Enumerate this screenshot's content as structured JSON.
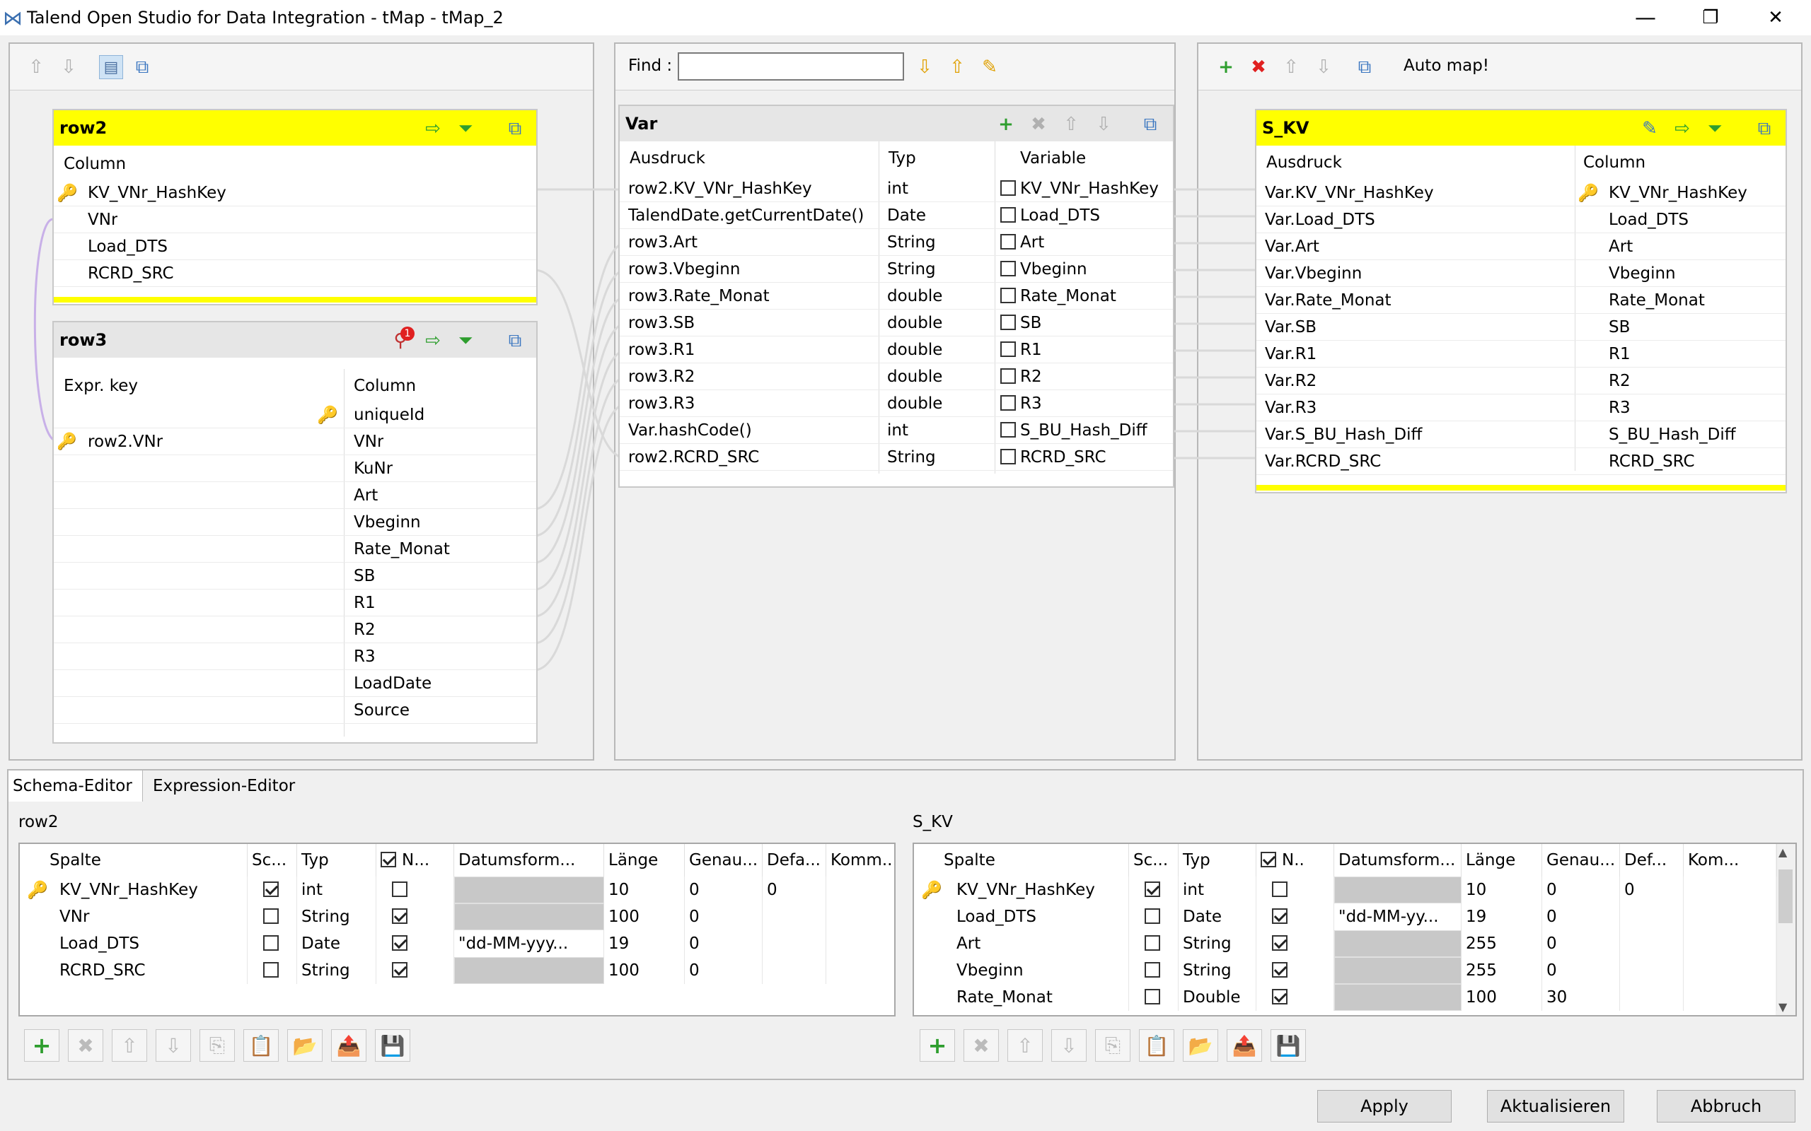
{
  "window": {
    "title": "Talend Open Studio for Data Integration - tMap - tMap_2",
    "minimize": "—",
    "restore": "❐",
    "close": "✕"
  },
  "colors": {
    "header_yellow": "#ffff00",
    "key_icon": "#d4a400",
    "add_green": "#2e9e2e",
    "remove_red": "#e02020"
  },
  "center": {
    "find_label": "Find :",
    "find_value": ""
  },
  "right": {
    "automap_label": "Auto map!"
  },
  "row2": {
    "title": "row2",
    "column_header": "Column",
    "rows": [
      "KV_VNr_HashKey",
      "VNr",
      "Load_DTS",
      "RCRD_SRC"
    ]
  },
  "row3": {
    "title": "row3",
    "expr_header": "Expr. key",
    "column_header": "Column",
    "badge": "1",
    "expr_values": [
      "",
      "row2.VNr"
    ],
    "rows": [
      "uniqueId",
      "VNr",
      "KuNr",
      "Art",
      "Vbeginn",
      "Rate_Monat",
      "SB",
      "R1",
      "R2",
      "R3",
      "LoadDate",
      "Source"
    ]
  },
  "var": {
    "title": "Var",
    "h_expr": "Ausdruck",
    "h_type": "Typ",
    "h_var": "Variable",
    "rows": [
      {
        "expr": "row2.KV_VNr_HashKey",
        "type": "int",
        "var": "KV_VNr_HashKey"
      },
      {
        "expr": "TalendDate.getCurrentDate()",
        "type": "Date",
        "var": "Load_DTS"
      },
      {
        "expr": "row3.Art",
        "type": "String",
        "var": "Art"
      },
      {
        "expr": "row3.Vbeginn",
        "type": "String",
        "var": "Vbeginn"
      },
      {
        "expr": "row3.Rate_Monat",
        "type": "double",
        "var": "Rate_Monat"
      },
      {
        "expr": "row3.SB",
        "type": "double",
        "var": "SB"
      },
      {
        "expr": "row3.R1",
        "type": "double",
        "var": "R1"
      },
      {
        "expr": "row3.R2",
        "type": "double",
        "var": "R2"
      },
      {
        "expr": "row3.R3",
        "type": "double",
        "var": "R3"
      },
      {
        "expr": "Var.hashCode()",
        "type": "int",
        "var": "S_BU_Hash_Diff"
      },
      {
        "expr": "row2.RCRD_SRC",
        "type": "String",
        "var": "RCRD_SRC"
      }
    ]
  },
  "skv": {
    "title": "S_KV",
    "h_expr": "Ausdruck",
    "h_col": "Column",
    "rows": [
      {
        "expr": "Var.KV_VNr_HashKey",
        "col": "KV_VNr_HashKey"
      },
      {
        "expr": "Var.Load_DTS",
        "col": "Load_DTS"
      },
      {
        "expr": "Var.Art",
        "col": "Art"
      },
      {
        "expr": "Var.Vbeginn",
        "col": "Vbeginn"
      },
      {
        "expr": "Var.Rate_Monat",
        "col": "Rate_Monat"
      },
      {
        "expr": "Var.SB",
        "col": "SB"
      },
      {
        "expr": "Var.R1",
        "col": "R1"
      },
      {
        "expr": "Var.R2",
        "col": "R2"
      },
      {
        "expr": "Var.R3",
        "col": "R3"
      },
      {
        "expr": "Var.S_BU_Hash_Diff",
        "col": "S_BU_Hash_Diff"
      },
      {
        "expr": "Var.RCRD_SRC",
        "col": "RCRD_SRC"
      }
    ]
  },
  "tabs": [
    "Schema-Editor",
    "Expression-Editor"
  ],
  "schema_left": {
    "label": "row2",
    "headers": [
      "Spalte",
      "Sc...",
      "Typ",
      "N...",
      "Datumsform...",
      "Länge",
      "Genau...",
      "Defa...",
      "Komm..."
    ],
    "rows": [
      {
        "name": "KV_VNr_HashKey",
        "key": true,
        "type": "int",
        "nullable": false,
        "fmt": "",
        "len": "10",
        "prec": "0",
        "def": "0"
      },
      {
        "name": "VNr",
        "key": false,
        "type": "String",
        "nullable": true,
        "fmt": "",
        "len": "100",
        "prec": "0",
        "def": ""
      },
      {
        "name": "Load_DTS",
        "key": false,
        "type": "Date",
        "nullable": true,
        "fmt": "\"dd-MM-yyy...",
        "len": "19",
        "prec": "0",
        "def": ""
      },
      {
        "name": "RCRD_SRC",
        "key": false,
        "type": "String",
        "nullable": true,
        "fmt": "",
        "len": "100",
        "prec": "0",
        "def": ""
      }
    ]
  },
  "schema_right": {
    "label": "S_KV",
    "headers": [
      "Spalte",
      "Sc...",
      "Typ",
      "N..",
      "Datumsform...",
      "Länge",
      "Genau...",
      "Def...",
      "Kom..."
    ],
    "rows": [
      {
        "name": "KV_VNr_HashKey",
        "key": true,
        "type": "int",
        "nullable": false,
        "fmt": "",
        "len": "10",
        "prec": "0",
        "def": "0"
      },
      {
        "name": "Load_DTS",
        "key": false,
        "type": "Date",
        "nullable": true,
        "fmt": "\"dd-MM-yy...",
        "len": "19",
        "prec": "0",
        "def": ""
      },
      {
        "name": "Art",
        "key": false,
        "type": "String",
        "nullable": true,
        "fmt": "",
        "len": "255",
        "prec": "0",
        "def": ""
      },
      {
        "name": "Vbeginn",
        "key": false,
        "type": "String",
        "nullable": true,
        "fmt": "",
        "len": "255",
        "prec": "0",
        "def": ""
      },
      {
        "name": "Rate_Monat",
        "key": false,
        "type": "Double",
        "nullable": true,
        "fmt": "",
        "len": "100",
        "prec": "30",
        "def": ""
      }
    ]
  },
  "buttons": {
    "apply": "Apply",
    "refresh": "Aktualisieren",
    "cancel": "Abbruch"
  }
}
